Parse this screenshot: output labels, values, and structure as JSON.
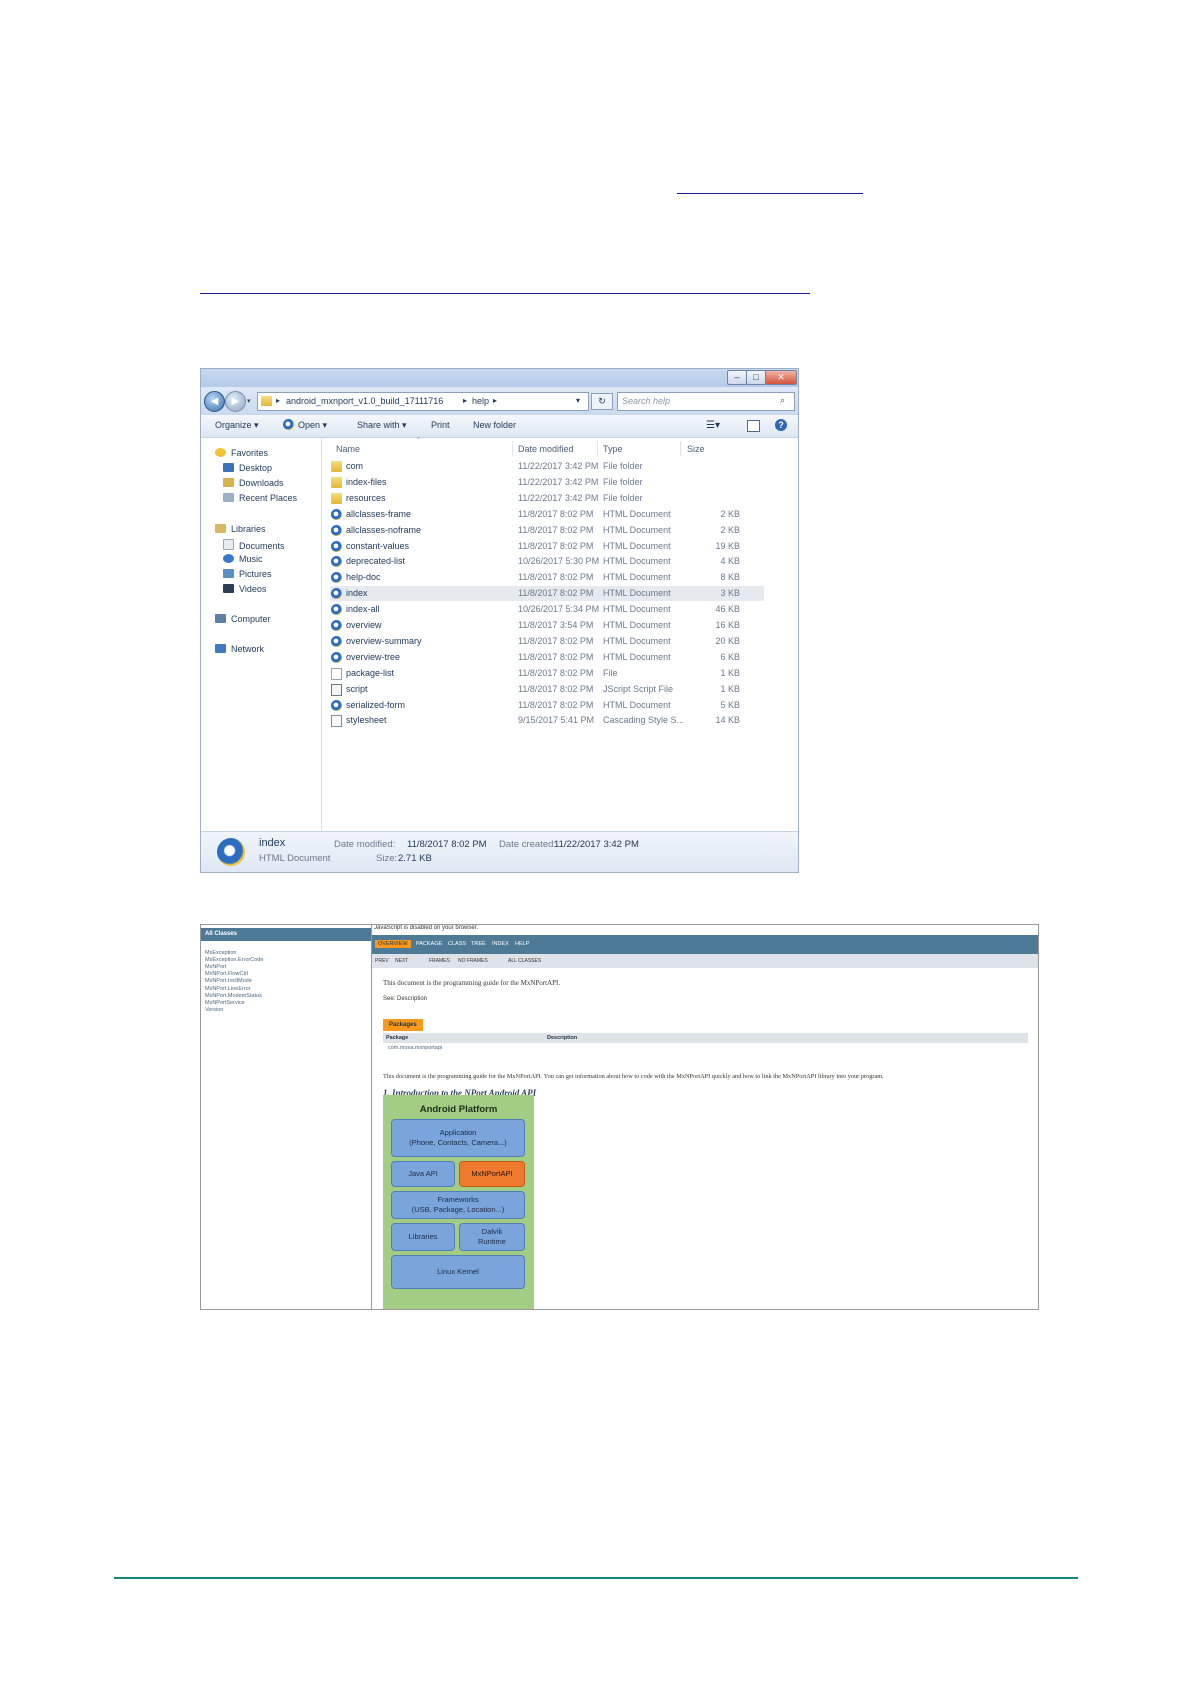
{
  "explorer": {
    "window_controls": [
      "–",
      "□",
      "✕"
    ],
    "path": [
      "android_mxnport_v1.0_build_17111716",
      "help"
    ],
    "search_placeholder": "Search help",
    "toolbar": {
      "organize": "Organize ▾",
      "open": "Open ▾",
      "share_with": "Share with ▾",
      "print": "Print",
      "new_folder": "New folder"
    },
    "nav": {
      "favorites": "Favorites",
      "desktop": "Desktop",
      "downloads": "Downloads",
      "recent_places": "Recent Places",
      "libraries": "Libraries",
      "documents": "Documents",
      "music": "Music",
      "pictures": "Pictures",
      "videos": "Videos",
      "computer": "Computer",
      "network": "Network"
    },
    "columns": {
      "name": "Name",
      "date": "Date modified",
      "type": "Type",
      "size": "Size"
    },
    "files": [
      {
        "name": "com",
        "date": "11/22/2017 3:42 PM",
        "type": "File folder",
        "size": "",
        "icon": "folder"
      },
      {
        "name": "index-files",
        "date": "11/22/2017 3:42 PM",
        "type": "File folder",
        "size": "",
        "icon": "folder"
      },
      {
        "name": "resources",
        "date": "11/22/2017 3:42 PM",
        "type": "File folder",
        "size": "",
        "icon": "folder"
      },
      {
        "name": "allclasses-frame",
        "date": "11/8/2017 8:02 PM",
        "type": "HTML Document",
        "size": "2 KB",
        "icon": "html"
      },
      {
        "name": "allclasses-noframe",
        "date": "11/8/2017 8:02 PM",
        "type": "HTML Document",
        "size": "2 KB",
        "icon": "html"
      },
      {
        "name": "constant-values",
        "date": "11/8/2017 8:02 PM",
        "type": "HTML Document",
        "size": "19 KB",
        "icon": "html"
      },
      {
        "name": "deprecated-list",
        "date": "10/26/2017 5:30 PM",
        "type": "HTML Document",
        "size": "4 KB",
        "icon": "html"
      },
      {
        "name": "help-doc",
        "date": "11/8/2017 8:02 PM",
        "type": "HTML Document",
        "size": "8 KB",
        "icon": "html"
      },
      {
        "name": "index",
        "date": "11/8/2017 8:02 PM",
        "type": "HTML Document",
        "size": "3 KB",
        "icon": "html"
      },
      {
        "name": "index-all",
        "date": "10/26/2017 5:34 PM",
        "type": "HTML Document",
        "size": "46 KB",
        "icon": "html"
      },
      {
        "name": "overview",
        "date": "11/8/2017 3:54 PM",
        "type": "HTML Document",
        "size": "16 KB",
        "icon": "html"
      },
      {
        "name": "overview-summary",
        "date": "11/8/2017 8:02 PM",
        "type": "HTML Document",
        "size": "20 KB",
        "icon": "html"
      },
      {
        "name": "overview-tree",
        "date": "11/8/2017 8:02 PM",
        "type": "HTML Document",
        "size": "6 KB",
        "icon": "html"
      },
      {
        "name": "package-list",
        "date": "11/8/2017 8:02 PM",
        "type": "File",
        "size": "1 KB",
        "icon": "file"
      },
      {
        "name": "script",
        "date": "11/8/2017 8:02 PM",
        "type": "JScript Script File",
        "size": "1 KB",
        "icon": "script"
      },
      {
        "name": "serialized-form",
        "date": "11/8/2017 8:02 PM",
        "type": "HTML Document",
        "size": "5 KB",
        "icon": "html"
      },
      {
        "name": "stylesheet",
        "date": "9/15/2017 5:41 PM",
        "type": "Cascading Style S...",
        "size": "14 KB",
        "icon": "css"
      }
    ],
    "selected_file": "index",
    "status": {
      "name": "index",
      "type": "HTML Document",
      "date_modified_label": "Date modified:",
      "date_modified": "11/8/2017 8:02 PM",
      "date_created_label": "Date created:",
      "date_created": "11/22/2017 3:42 PM",
      "size_label": "Size:",
      "size": "2.71 KB"
    }
  },
  "javadoc": {
    "all_classes_header": "All Classes",
    "classes": [
      "MxException",
      "MxException.ErrorCode",
      "MxNPort",
      "MxNPort.FlowCtrl",
      "MxNPort.IoctlMode",
      "MxNPort.LineError",
      "MxNPort.ModemStatus",
      "MxNPortService",
      "Version"
    ],
    "js_message": "JavaScript is disabled on your browser.",
    "top_nav": [
      "OVERVIEW",
      "PACKAGE",
      "CLASS",
      "TREE",
      "INDEX",
      "HELP"
    ],
    "sub_nav": [
      "PREV",
      "NEXT",
      "FRAMES",
      "NO FRAMES",
      "ALL CLASSES"
    ],
    "intro": "This document is the programming guide for the MxNPortAPI.",
    "see": "See: Description",
    "packages_tab": "Packages",
    "table_headers": [
      "Package",
      "Description"
    ],
    "package_name": "com.moxa.mxnportapi",
    "description": "This document is the programming guide for the MxNPortAPI. You can get information about how to code with the MxNPortAPI quickly and how to link the MxNPortAPI library into your program.",
    "section_title": "1. Introduction to the NPort Android API",
    "diagram": {
      "title": "Android Platform",
      "application": "Application",
      "application_sub": "(Phone, Contacts, Camera...)",
      "java_api": "Java API",
      "mxnportapi": "MxNPortAPI",
      "frameworks": "Frameworks",
      "frameworks_sub": "(USB, Package, Location...)",
      "libraries": "Libraries",
      "dalvik": "Dalvik",
      "dalvik_sub": "Runtime",
      "linux_kernel": "Linux Kernel"
    }
  },
  "colors": {
    "javadoc_nav": "#4d7a97",
    "javadoc_orange": "#f8981d",
    "diagram_green": "#a2cd82",
    "diagram_blue": "#7aa5dc",
    "diagram_orange": "#ef7a2e",
    "footer_line": "#17857a",
    "link_line": "#1a1aa6"
  }
}
